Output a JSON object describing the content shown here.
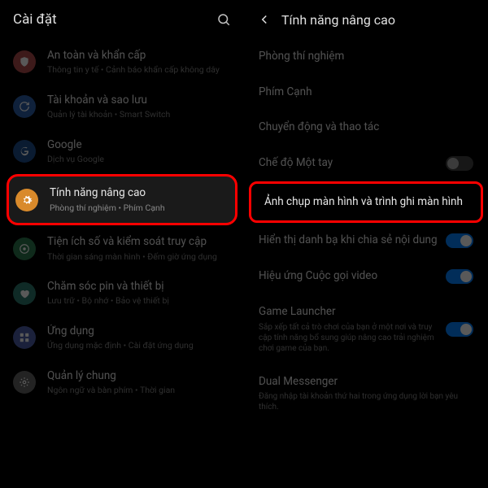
{
  "left": {
    "title": "Cài đặt",
    "items": [
      {
        "title": "An toàn và khẩn cấp",
        "sub": "Thông tin y tế  •  Cảnh báo khẩn cấp không dây",
        "iconColor": "#b04a4a",
        "glyph": "shield"
      },
      {
        "title": "Tài khoản và sao lưu",
        "sub": "Quản lý tài khoản  •  Smart Switch",
        "iconColor": "#2d5fa8",
        "glyph": "sync"
      },
      {
        "title": "Google",
        "sub": "Dịch vụ Google",
        "iconColor": "#1e4d8c",
        "glyph": "google"
      },
      {
        "title": "Tính năng nâng cao",
        "sub": "Phòng thí nghiệm  •  Phím Cạnh",
        "iconColor": "#d98a2b",
        "glyph": "gear",
        "highlight": true
      },
      {
        "title": "Tiện ích số và kiểm soát truy cập",
        "sub": "Thời gian sáng màn hình  •  Đếm giờ ứng dụng",
        "iconColor": "#2d7a4d",
        "glyph": "wellbeing"
      },
      {
        "title": "Chăm sóc pin và thiết bị",
        "sub": "Lưu trữ  •  Bộ nhớ  •  Bảo vệ thiết bị",
        "iconColor": "#2d7a6d",
        "glyph": "heart"
      },
      {
        "title": "Ứng dụng",
        "sub": "Ứng dụng mặc định  •  Cài đặt ứng dụng",
        "iconColor": "#4d5fa8",
        "glyph": "grid"
      },
      {
        "title": "Quản lý chung",
        "sub": "Ngôn ngữ và bàn phím  •  Thời gian",
        "iconColor": "#666",
        "glyph": "cog"
      }
    ]
  },
  "right": {
    "title": "Tính năng nâng cao",
    "items": [
      {
        "title": "Phòng thí nghiệm"
      },
      {
        "title": "Phím Cạnh"
      },
      {
        "title": "Chuyển động và thao tác"
      },
      {
        "title": "Chế độ Một tay",
        "toggle": "off"
      },
      {
        "title": "Ảnh chụp màn hình và trình ghi màn hình",
        "highlight": true
      },
      {
        "title": "Hiển thị danh bạ khi chia sẻ nội dung",
        "toggle": "on"
      },
      {
        "title": "Hiệu ứng Cuộc gọi video",
        "toggle": "on"
      },
      {
        "title": "Game Launcher",
        "sub": "Sắp xếp tất cả trò chơi của bạn ở một nơi và truy cập tính năng bổ sung giúp nâng cao trải nghiệm chơi game của bạn.",
        "toggle": "on"
      },
      {
        "title": "Dual Messenger",
        "sub": "Đăng nhập tài khoản thứ hai trong ứng dụng lời bạn yêu thích."
      }
    ]
  }
}
